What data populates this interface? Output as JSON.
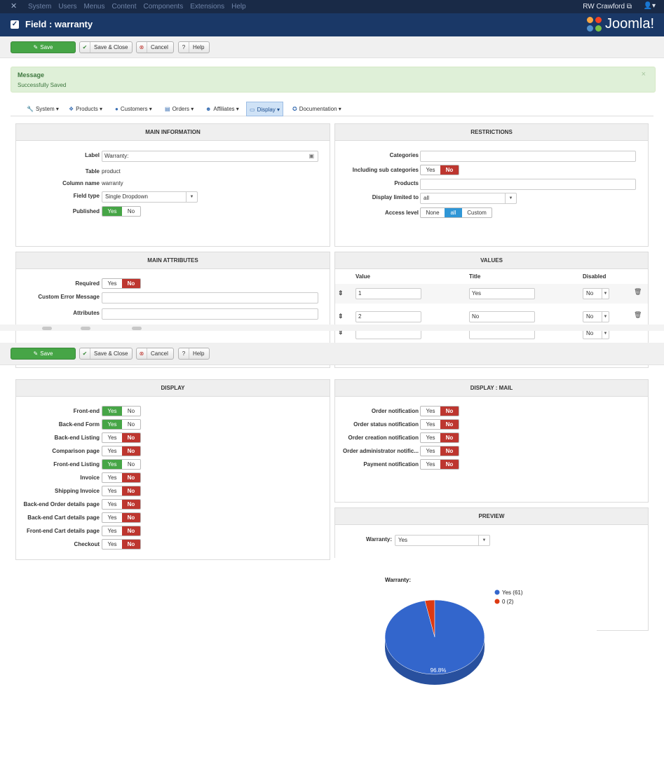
{
  "topbar": {
    "menu": [
      "System",
      "Users",
      "Menus",
      "Content",
      "Components",
      "Extensions",
      "Help"
    ],
    "user": "RW Crawford"
  },
  "titlebar": {
    "title": "Field : warranty",
    "logo_text": "Joomla!"
  },
  "toolbar": {
    "save": "Save",
    "save_close": "Save & Close",
    "cancel": "Cancel",
    "help": "Help"
  },
  "message": {
    "heading": "Message",
    "body": "Successfully Saved",
    "close": "×"
  },
  "nav": {
    "system": "System",
    "products": "Products",
    "customers": "Customers",
    "orders": "Orders",
    "affiliates": "Affiliates",
    "display": "Display",
    "documentation": "Documentation"
  },
  "main_info": {
    "heading": "MAIN INFORMATION",
    "label_label": "Label",
    "label_value": "Warranty:",
    "table_label": "Table",
    "table_value": "product",
    "column_label": "Column name",
    "column_value": "warranty",
    "fieldtype_label": "Field type",
    "fieldtype_value": "Single Dropdown",
    "published_label": "Published"
  },
  "restrictions": {
    "heading": "RESTRICTIONS",
    "categories_label": "Categories",
    "subcat_label": "Including sub categories",
    "products_label": "Products",
    "display_limited_label": "Display limited to",
    "display_limited_value": "all",
    "access_label": "Access level",
    "access_none": "None",
    "access_all": "all",
    "access_custom": "Custom"
  },
  "main_attributes": {
    "heading": "MAIN ATTRIBUTES",
    "required_label": "Required",
    "custom_error_label": "Custom Error Message",
    "attributes_label": "Attributes"
  },
  "values": {
    "heading": "VALUES",
    "col_value": "Value",
    "col_title": "Title",
    "col_disabled": "Disabled",
    "rows": [
      {
        "value": "1",
        "title": "Yes",
        "disabled": "No"
      },
      {
        "value": "2",
        "title": "No",
        "disabled": "No"
      },
      {
        "value": "",
        "title": "",
        "disabled": "No"
      }
    ]
  },
  "toggle": {
    "yes": "Yes",
    "no": "No"
  },
  "display": {
    "heading": "DISPLAY",
    "rows": [
      "Front-end",
      "Back-end Form",
      "Back-end Listing",
      "Comparison page",
      "Front-end Listing",
      "Invoice",
      "Shipping Invoice",
      "Back-end Order details page",
      "Back-end Cart details page",
      "Front-end Cart details page",
      "Checkout"
    ]
  },
  "display_mail": {
    "heading": "DISPLAY : MAIL",
    "rows": [
      "Order notification",
      "Order status notification",
      "Order creation notification",
      "Order administrator notific...",
      "Payment notification"
    ]
  },
  "preview": {
    "heading": "PREVIEW",
    "label": "Warranty:",
    "value": "Yes"
  },
  "chart_data": {
    "type": "pie",
    "title": "Warranty:",
    "categories": [
      "Yes",
      "0"
    ],
    "values": [
      61,
      2
    ],
    "legend": [
      "Yes (61)",
      "0 (2)"
    ],
    "data_labels": [
      "96.8%"
    ],
    "colors": [
      "#3366cc",
      "#dc3912"
    ],
    "legend_position": "right"
  }
}
